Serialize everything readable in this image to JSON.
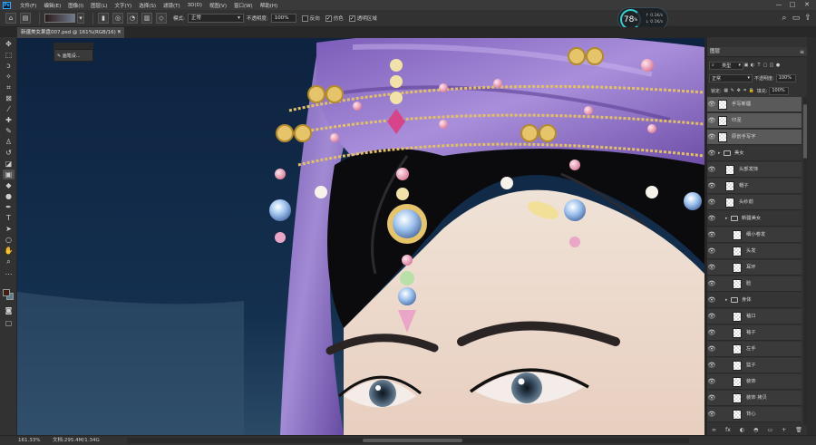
{
  "menu": [
    "文件(F)",
    "编辑(E)",
    "图像(I)",
    "图层(L)",
    "文字(Y)",
    "选择(S)",
    "滤镜(T)",
    "3D(D)",
    "视图(V)",
    "窗口(W)",
    "帮助(H)"
  ],
  "app_logo": "Ps",
  "window_controls": [
    "—",
    "□",
    "✕"
  ],
  "options_bar": {
    "mode_label": "模式:",
    "mode_value": "正常",
    "opacity_label": "不透明度:",
    "opacity_value": "100%",
    "reverse_label": "反向",
    "reverse_checked": false,
    "dither_label": "仿色",
    "dither_checked": true,
    "transparency_label": "透明区域",
    "transparency_checked": true
  },
  "performance": {
    "value": "78",
    "unit": "%",
    "stat1": "0.1K/s",
    "stat2": "0.1K/s"
  },
  "document_tab": {
    "title": "新疆美女果盘007.psd @ 161%(RGB/16) *",
    "close": "×"
  },
  "brush_popup": "画笔设...",
  "statusbar": {
    "zoom": "161.33%",
    "doc": "文档:295.4M/1.34G"
  },
  "colors": {
    "foreground": "#3f1f15",
    "background": "#5b7d92",
    "accent": "#31a8ff"
  },
  "layers_panel": {
    "title": "图层",
    "filter_value": "类型",
    "blend_mode": "正常",
    "opacity_label": "不透明度:",
    "opacity_value": "100%",
    "lock_label": "锁定:",
    "fill_label": "填充:",
    "fill_value": "100%",
    "layers": [
      {
        "name": "手写新疆",
        "type": "layer",
        "indent": 0,
        "selected": true
      },
      {
        "name": "印泥",
        "type": "layer",
        "indent": 0,
        "selected": true
      },
      {
        "name": "原创手写字",
        "type": "layer",
        "indent": 0,
        "selected": true
      },
      {
        "name": "美女",
        "type": "group",
        "indent": 0,
        "selected": false
      },
      {
        "name": "头部发饰",
        "type": "layer",
        "indent": 1,
        "selected": false
      },
      {
        "name": "帽子",
        "type": "layer",
        "indent": 1,
        "selected": false
      },
      {
        "name": "头纱前",
        "type": "layer",
        "indent": 1,
        "selected": false
      },
      {
        "name": "新疆美女",
        "type": "group",
        "indent": 1,
        "selected": false
      },
      {
        "name": "细小卷发",
        "type": "layer",
        "indent": 2,
        "selected": false
      },
      {
        "name": "头发",
        "type": "layer",
        "indent": 2,
        "selected": false
      },
      {
        "name": "耳环",
        "type": "layer",
        "indent": 2,
        "selected": false
      },
      {
        "name": "脸",
        "type": "layer",
        "indent": 2,
        "selected": false
      },
      {
        "name": "身体",
        "type": "group",
        "indent": 1,
        "selected": false
      },
      {
        "name": "袖口",
        "type": "layer",
        "indent": 2,
        "selected": false
      },
      {
        "name": "袖子",
        "type": "layer",
        "indent": 2,
        "selected": false
      },
      {
        "name": "左手",
        "type": "layer",
        "indent": 2,
        "selected": false
      },
      {
        "name": "篮子",
        "type": "layer",
        "indent": 2,
        "selected": false
      },
      {
        "name": "装饰",
        "type": "layer",
        "indent": 2,
        "selected": false
      },
      {
        "name": "装饰 拷贝",
        "type": "layer",
        "indent": 2,
        "selected": false
      },
      {
        "name": "背心",
        "type": "layer",
        "indent": 2,
        "selected": false
      }
    ],
    "footer_icons": [
      "∞",
      "fx",
      "◐",
      "◓",
      "▭",
      "+",
      "🗑"
    ]
  },
  "tools": [
    "move",
    "marquee",
    "lasso",
    "magic-wand",
    "crop",
    "frame",
    "eyedropper",
    "healing",
    "brush",
    "stamp",
    "history-brush",
    "eraser",
    "gradient",
    "blur",
    "dodge",
    "pen",
    "type",
    "path-select",
    "shape",
    "hand",
    "zoom",
    "more"
  ]
}
